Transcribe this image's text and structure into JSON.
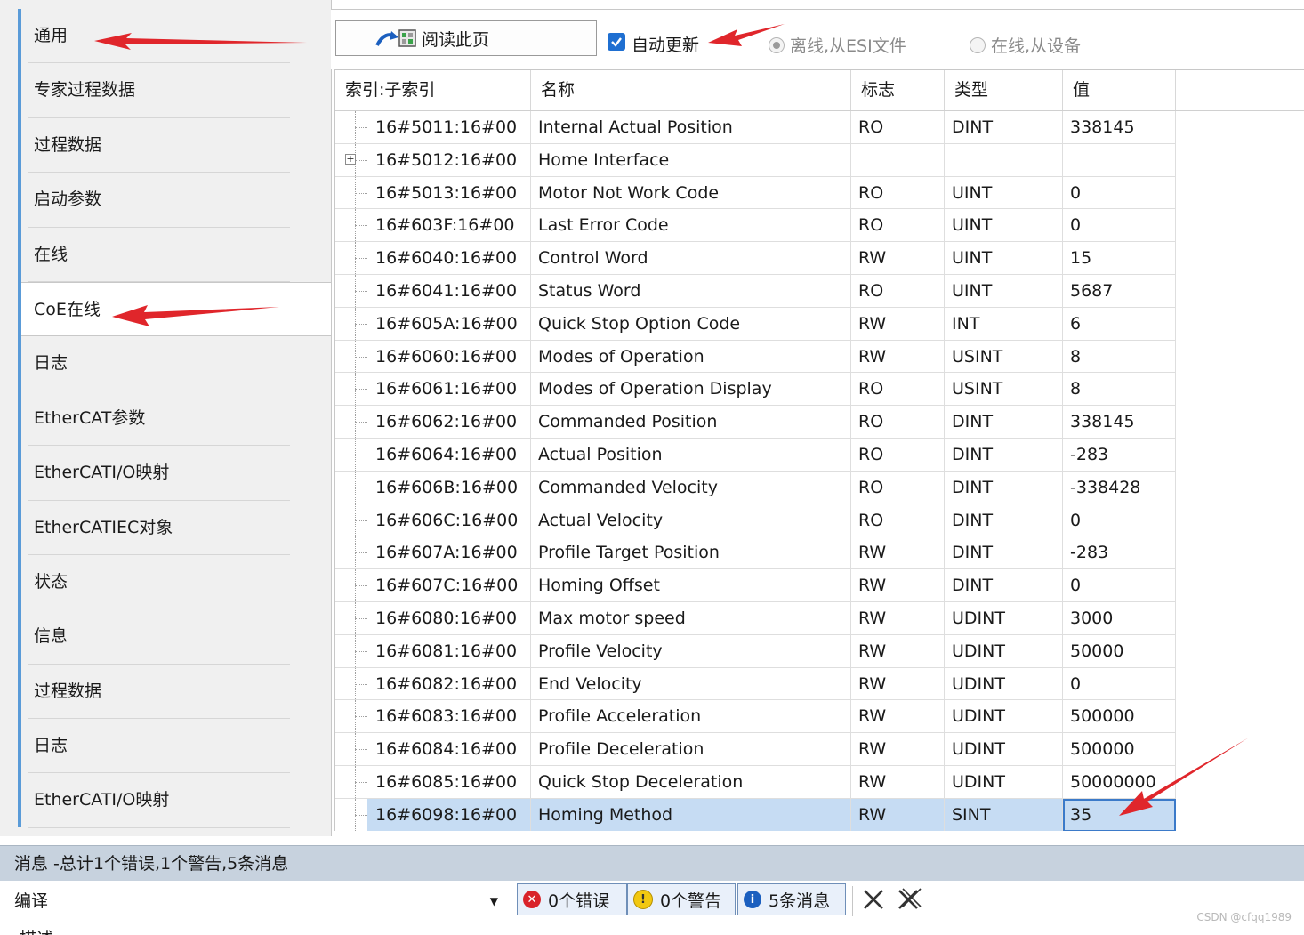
{
  "sidebar": {
    "items": [
      {
        "label": "通用"
      },
      {
        "label": "专家过程数据"
      },
      {
        "label": "过程数据"
      },
      {
        "label": "启动参数"
      },
      {
        "label": "在线"
      },
      {
        "label": "CoE在线",
        "active": true
      },
      {
        "label": "日志"
      },
      {
        "label": "EtherCAT参数"
      },
      {
        "label": "EtherCATI/O映射"
      },
      {
        "label": "EtherCATIEC对象"
      },
      {
        "label": "状态"
      },
      {
        "label": "信息"
      },
      {
        "label": "过程数据"
      },
      {
        "label": "日志"
      },
      {
        "label": "EtherCATI/O映射"
      }
    ]
  },
  "toolbar": {
    "read_label": "阅读此页",
    "auto_update_label": "自动更新",
    "auto_update_checked": true,
    "offline_label": "离线,从ESI文件",
    "online_label": "在线,从设备"
  },
  "grid": {
    "headers": [
      "索引:子索引",
      "名称",
      "标志",
      "类型",
      "值"
    ],
    "rows": [
      {
        "index": "16#5011:16#00",
        "name": "Internal Actual Position",
        "flag": "RO",
        "type": "DINT",
        "value": "338145"
      },
      {
        "index": "16#5012:16#00",
        "name": "Home Interface",
        "flag": "",
        "type": "",
        "value": "",
        "expandable": true
      },
      {
        "index": "16#5013:16#00",
        "name": "Motor Not Work Code",
        "flag": "RO",
        "type": "UINT",
        "value": "0"
      },
      {
        "index": "16#603F:16#00",
        "name": "Last Error Code",
        "flag": "RO",
        "type": "UINT",
        "value": "0"
      },
      {
        "index": "16#6040:16#00",
        "name": "Control Word",
        "flag": "RW",
        "type": "UINT",
        "value": "15"
      },
      {
        "index": "16#6041:16#00",
        "name": "Status Word",
        "flag": "RO",
        "type": "UINT",
        "value": "5687"
      },
      {
        "index": "16#605A:16#00",
        "name": "Quick Stop Option Code",
        "flag": "RW",
        "type": "INT",
        "value": "6"
      },
      {
        "index": "16#6060:16#00",
        "name": "Modes of Operation",
        "flag": "RW",
        "type": "USINT",
        "value": "8"
      },
      {
        "index": "16#6061:16#00",
        "name": "Modes of Operation Display",
        "flag": "RO",
        "type": "USINT",
        "value": "8"
      },
      {
        "index": "16#6062:16#00",
        "name": "Commanded Position",
        "flag": "RO",
        "type": "DINT",
        "value": "338145"
      },
      {
        "index": "16#6064:16#00",
        "name": "Actual Position",
        "flag": "RO",
        "type": "DINT",
        "value": "-283"
      },
      {
        "index": "16#606B:16#00",
        "name": "Commanded Velocity",
        "flag": "RO",
        "type": "DINT",
        "value": "-338428"
      },
      {
        "index": "16#606C:16#00",
        "name": "Actual Velocity",
        "flag": "RO",
        "type": "DINT",
        "value": "0"
      },
      {
        "index": "16#607A:16#00",
        "name": "Profile Target Position",
        "flag": "RW",
        "type": "DINT",
        "value": "-283"
      },
      {
        "index": "16#607C:16#00",
        "name": "Homing Offset",
        "flag": "RW",
        "type": "DINT",
        "value": "0"
      },
      {
        "index": "16#6080:16#00",
        "name": "Max motor speed",
        "flag": "RW",
        "type": "UDINT",
        "value": "3000"
      },
      {
        "index": "16#6081:16#00",
        "name": "Profile Velocity",
        "flag": "RW",
        "type": "UDINT",
        "value": "50000"
      },
      {
        "index": "16#6082:16#00",
        "name": "End Velocity",
        "flag": "RW",
        "type": "UDINT",
        "value": "0"
      },
      {
        "index": "16#6083:16#00",
        "name": "Profile Acceleration",
        "flag": "RW",
        "type": "UDINT",
        "value": "500000"
      },
      {
        "index": "16#6084:16#00",
        "name": "Profile Deceleration",
        "flag": "RW",
        "type": "UDINT",
        "value": "500000"
      },
      {
        "index": "16#6085:16#00",
        "name": "Quick Stop Deceleration",
        "flag": "RW",
        "type": "UDINT",
        "value": "50000000"
      },
      {
        "index": "16#6098:16#00",
        "name": "Homing Method",
        "flag": "RW",
        "type": "SINT",
        "value": "35",
        "selected": true
      }
    ]
  },
  "messages": {
    "header": "消息 -总计1个错误,1个警告,5条消息",
    "filter_value": "编译",
    "errors_label": "0个错误",
    "warnings_label": "0个警告",
    "info_label": "5条消息",
    "list_header_partial": "描述"
  },
  "watermark": "CSDN @cfqq1989",
  "colors": {
    "accent_blue": "#1f6fd1",
    "selection": "#c6dcf3",
    "annotation_red": "#e0262b",
    "error_red": "#d9232a",
    "warning_yellow": "#f2c811",
    "info_blue": "#1b5fbf"
  },
  "icons": {
    "read_button": "refresh-read-icon",
    "errors": "error-circle-icon",
    "warnings": "warning-circle-icon",
    "info": "info-circle-icon",
    "clear": "clear-x-icon",
    "clear_all": "clear-all-icon"
  }
}
